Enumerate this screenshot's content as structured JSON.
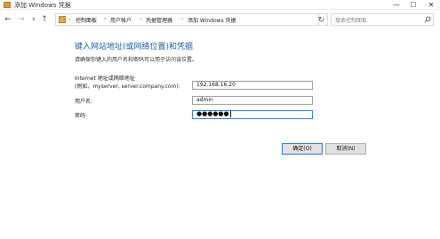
{
  "window": {
    "title": "添加 Windows 凭据",
    "minimize_glyph": "—",
    "maximize_glyph": "☐",
    "close_glyph": "✕"
  },
  "nav": {
    "back_glyph": "←",
    "forward_glyph": "→",
    "recent_glyph": "∨",
    "up_glyph": "↑",
    "breadcrumb": [
      "控制面板",
      "用户帐户",
      "凭据管理器",
      "添加 Windows 凭据"
    ],
    "separator": "›",
    "dropdown_glyph": "∨",
    "refresh_glyph": "↻",
    "search_placeholder": "搜索控制面板"
  },
  "main": {
    "heading": "键入网站地址(或网络位置)和凭据",
    "subheading": "请确保你键入的用户名和密码可以用于访问该位置。",
    "address_label_line1": "Internet 地址或网络地址",
    "address_label_line2": "(例如，myserver, server.company.com):",
    "address_value": "192.168.16.20",
    "username_label": "用户名:",
    "username_value": "admin",
    "password_label": "密码:",
    "password_value": "●●●●●●"
  },
  "buttons": {
    "ok": "确定(O)",
    "cancel": "取消(N)"
  },
  "colors": {
    "heading": "#1e5f9b",
    "focus_border": "#2a7ac9",
    "folder_icon": "#e2a64a"
  }
}
